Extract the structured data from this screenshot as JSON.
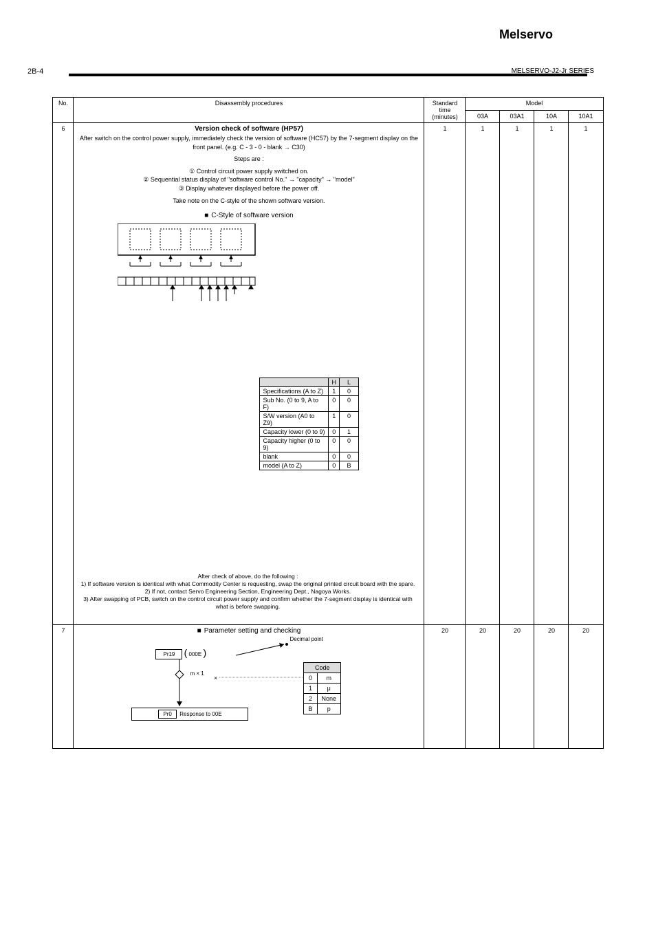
{
  "header": {
    "title_line1": "Melservo",
    "title_line2": "MELSERVO-J2-Jr SERIES",
    "page_number": "2B-4",
    "section_tag": "J2-Jr"
  },
  "columns": {
    "no": "No.",
    "proc": "Disassembly procedures",
    "time": "Standard time (minutes)",
    "model": "Model",
    "m03A": "03A",
    "m03A1": "03A1",
    "m10A": "10A",
    "m10A1": "10A1"
  },
  "row6": {
    "no": "6",
    "title": "Version check of software (HP57)",
    "body1": "After switch on the control power supply, immediately check the version of software (HC57) by the 7-segment display on the front panel. ",
    "body1_eg": "(e.g. C - 3 - 0 - blank → C30)",
    "body2": "Steps are :",
    "steps": "① Control circuit power supply switched on.\n② Sequential status display of \"software control No.\" → \"capacity\" → \"model\"\n③ Display whatever displayed before the power off.",
    "body3": "Take note on the C-style of the shown software version.",
    "cstyle_label": "C-Style of software version",
    "seg_hdr_h": "H",
    "seg_hdr_l": "L",
    "seg_rows": [
      {
        "name": "Specifications (A to Z)",
        "h": "1",
        "l": "0"
      },
      {
        "name": "Sub No. (0 to 9, A to F)",
        "h": "0",
        "l": "0"
      },
      {
        "name": "S/W version (A0 to Z9)",
        "h": "1",
        "l": "0"
      },
      {
        "name": "Capacity lower (0 to 9)",
        "h": "0",
        "l": "1"
      },
      {
        "name": "Capacity higher (0 to 9)",
        "h": "0",
        "l": "0"
      },
      {
        "name": "blank",
        "h": "0",
        "l": "0"
      },
      {
        "name": "model (A to Z)",
        "h": "0",
        "l": "B"
      }
    ],
    "after": "After check of above, do the following :\n1) If software version is identical with what Commodity Center is requesting, swap the original printed circuit board with the spare.\n2) If not, contact Servo Engineering Section, Engineering Dept., Nagoya Works.\n3) After swapping of PCB, switch on the control circuit power supply and confirm whether the 7-segment display is identical with what is before swapping.",
    "time": "1",
    "m03A": "1",
    "m03A1": "1",
    "m10A": "1",
    "m10A1": "1"
  },
  "row7": {
    "no": "7",
    "title": "Parameter setting and checking",
    "box_top": "Pr19",
    "box_top_sub": "000E",
    "mx": "m × 1",
    "decimal": "Decimal point",
    "code_label": "Code",
    "code_r0": {
      "code": "0",
      "val": "m"
    },
    "code_r1": {
      "code": "1",
      "val": "μ"
    },
    "code_r2": {
      "code": "2",
      "val": "None"
    },
    "code_r3": {
      "code": "B",
      "val": "p"
    },
    "big_box_l1": "Pr0",
    "big_box_l2": "Response to 00E",
    "time": "20",
    "m03A": "20",
    "m03A1": "20",
    "m10A": "20",
    "m10A1": "20"
  }
}
